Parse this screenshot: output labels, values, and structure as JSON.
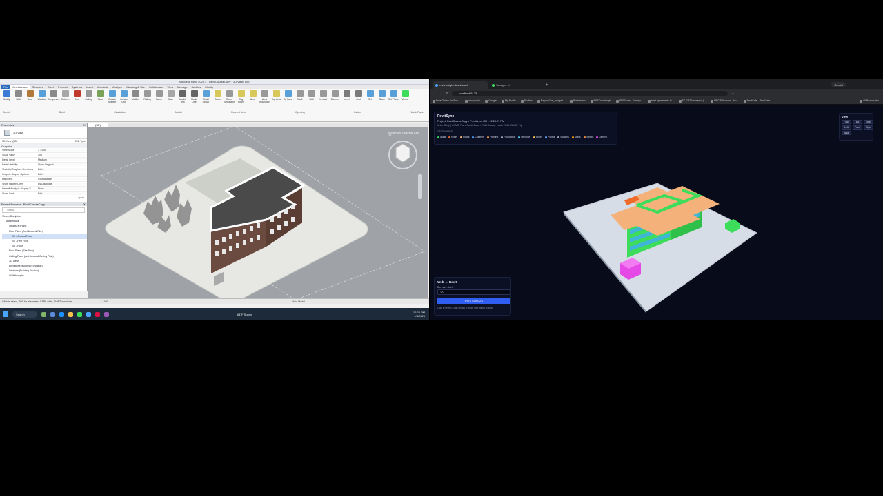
{
  "revit": {
    "title": "Autodesk Revit 2025.4 - RevitCourseCopy - 3D View: {3D}",
    "user": "mayur.reddy",
    "tabs": [
      "File",
      "Architecture",
      "Structure",
      "Steel",
      "Precast",
      "Systems",
      "Insert",
      "Annotate",
      "Analyze",
      "Massing & Site",
      "Collaborate",
      "View",
      "Manage",
      "Add-Ins",
      "Modify"
    ],
    "ribbon_buttons": [
      "Modify",
      "Wall",
      "Door",
      "Window",
      "Component",
      "Column",
      "Roof",
      "Ceiling",
      "Floor",
      "Curtain System",
      "Curtain Grid",
      "Mullion",
      "Railing",
      "Ramp",
      "Stair",
      "Model Text",
      "Model Line",
      "Model Group",
      "Room",
      "Room Separator",
      "Tag Room",
      "Area",
      "Area Boundary",
      "Tag Area",
      "By Face",
      "Shaft",
      "Wall",
      "Vertical",
      "Dormer",
      "Level",
      "Grid",
      "Set",
      "Show",
      "Ref Plane",
      "Viewer"
    ],
    "ribbon_panels": [
      "Select",
      "Build",
      "Circulation",
      "Model",
      "Room & Area",
      "Opening",
      "Datum",
      "Work Plane"
    ],
    "properties": {
      "header": "Properties",
      "type": "3D View",
      "selector": "3D View: {3D}",
      "edit_type": "Edit Type",
      "group": "Graphics",
      "rows": [
        [
          "View Scale",
          "1 : 100"
        ],
        [
          "Scale Value",
          "100"
        ],
        [
          "Detail Level",
          "Medium"
        ],
        [
          "Parts Visibility",
          "Show Original"
        ],
        [
          "Visibility/Graphics Overrides",
          "Edit..."
        ],
        [
          "Graphic Display Options",
          "Edit..."
        ],
        [
          "Discipline",
          "Coordination"
        ],
        [
          "Show Hidden Lines",
          "By Discipline"
        ],
        [
          "Default Analysis Display S...",
          "None"
        ],
        [
          "Show Grids",
          "Edit..."
        ]
      ],
      "apply": "Apply"
    },
    "browser": {
      "header": "Project Browser - RevitCourseCopy",
      "search": "Search",
      "items": [
        "Views (Discipline)",
        "Architectural",
        "Structural Plans",
        "Floor Plans (Architectural Plan)",
        "01 - Ground Floor",
        "02 - First Floor",
        "03 - Roof",
        "Floor Plans (Site Plan)",
        "Ceiling Plans (Architectural Ceiling Plan)",
        "3D Views",
        "Elevations (Building Elevation)",
        "Sections (Building Section)",
        "Walkthroughs"
      ]
    },
    "view_tab": "{3D}",
    "graphics_note": "Accelerated Graphics Turn Off",
    "status_left": "Click to select, TAB for alternates, CTRL adds, SHIFT unselects.",
    "scale": "1 : 100",
    "main_model": "Main Model"
  },
  "taskbar": {
    "search": "Search",
    "weather": "64°F Sunny",
    "time": "12:25 PM",
    "date": "1/4/2026"
  },
  "chrome": {
    "tabs": [
      {
        "label": "revit-insight-dashboard",
        "active": true
      },
      {
        "label": "Swagger UI",
        "active": false
      }
    ],
    "gemini": "Gemini",
    "url": "localhost:5173",
    "bookmarks": [
      "Free Online YouTub...",
      "www.youtu",
      "Google",
      "My Profile",
      "Studies",
      "Rayvon3/ai_navigati...",
      "Brainstorm",
      "IRISZoomLogin",
      "IRISZoom - Foreign...",
      "best apartments in...",
      "FT GPT Insurance |...",
      "USCIS Account - Ho...",
      "RentCafe - RentCafe",
      "All Bookmarks"
    ]
  },
  "app": {
    "title": "RevitSync",
    "project_line": "Project: RevitCourseCopy • Primitives: 433 • 12:25:07 PM",
    "units_line": "Units: Grid(s) • WMB: Pan • Scroll: Zoom • RMB+Mouse: Look • RMB+WASD: Fly",
    "categories_label": "CATEGORIES",
    "categories": [
      {
        "name": "Walls",
        "color": "#3ddc5a"
      },
      {
        "name": "Roofs",
        "color": "#f06a2a"
      },
      {
        "name": "Floors",
        "color": "#f4b27a"
      },
      {
        "name": "Columns",
        "color": "#4aa3ff"
      },
      {
        "name": "Framing",
        "color": "#f0a04a"
      },
      {
        "name": "Foundation",
        "color": "#aab0bb"
      },
      {
        "name": "Windows",
        "color": "#4ad4ff"
      },
      {
        "name": "Doors",
        "color": "#f2c14e"
      },
      {
        "name": "Panels",
        "color": "#60a5fa"
      },
      {
        "name": "Mullions",
        "color": "#9ca3af"
      },
      {
        "name": "Stairs",
        "color": "#f59e0b"
      },
      {
        "name": "Ramps",
        "color": "#ef8a3a"
      },
      {
        "name": "Generic",
        "color": "#e64ae6"
      }
    ],
    "view": {
      "title": "View",
      "buttons": [
        "Top",
        "Iso",
        "Bot",
        "Left",
        "Front",
        "Right",
        "Back"
      ]
    },
    "web": {
      "title": "Web → Revit",
      "label": "Box size (feet)",
      "value": "10",
      "button": "Click to Place",
      "hint": "Click to select • Drag arrows to move • Re-import to sync"
    }
  },
  "colors": {
    "accent": "#2f5ef0",
    "roof": "#f4b27a",
    "wall": "#3ddc5a",
    "window": "#3fb6d8",
    "generic": "#e64ae6",
    "site": "#d6dde6"
  }
}
